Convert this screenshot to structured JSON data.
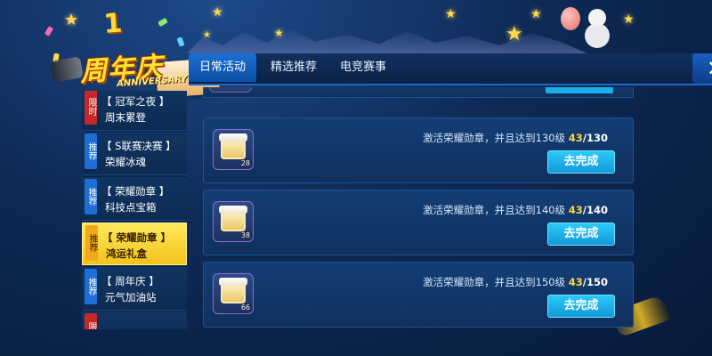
{
  "logo": {
    "main": "周年庆",
    "sub": "ANNIVERSARY",
    "number": "1"
  },
  "tabs": [
    {
      "label": "日常活动",
      "active": true
    },
    {
      "label": "精选推荐",
      "active": false
    },
    {
      "label": "电竞赛事",
      "active": false
    }
  ],
  "close_label": "✕",
  "sidebar": [
    {
      "badge": "限时",
      "badge_color": "red",
      "line1": "【 冠军之夜 】",
      "line2": "周末累登",
      "active": false
    },
    {
      "badge": "推荐",
      "badge_color": "blue",
      "line1": "【 S联赛决赛 】",
      "line2": "荣耀冰魂",
      "active": false
    },
    {
      "badge": "推荐",
      "badge_color": "blue",
      "line1": "【 荣耀勋章 】",
      "line2": "科技点宝箱",
      "active": false
    },
    {
      "badge": "推荐",
      "badge_color": "blue",
      "line1": "【 荣耀勋章 】",
      "line2": "鸿运礼盒",
      "active": true
    },
    {
      "badge": "推荐",
      "badge_color": "blue",
      "line1": "【 周年庆 】",
      "line2": "元气加油站",
      "active": false
    },
    {
      "badge": "限时",
      "badge_color": "red",
      "line1": "",
      "line2": "",
      "active": false
    }
  ],
  "tasks": [
    {
      "count": "28",
      "desc": "激活荣耀勋章，并且达到130级",
      "progress_current": "43",
      "progress_total": "/130",
      "button": "去完成"
    },
    {
      "count": "38",
      "desc": "激活荣耀勋章，并且达到140级",
      "progress_current": "43",
      "progress_total": "/140",
      "button": "去完成"
    },
    {
      "count": "66",
      "desc": "激活荣耀勋章，并且达到150级",
      "progress_current": "43",
      "progress_total": "/150",
      "button": "去完成"
    }
  ],
  "colors": {
    "accent": "#1b6fd2",
    "button": "#1fb4ec",
    "active_sidebar": "#f7d23a",
    "progress_highlight": "#ffd634"
  }
}
